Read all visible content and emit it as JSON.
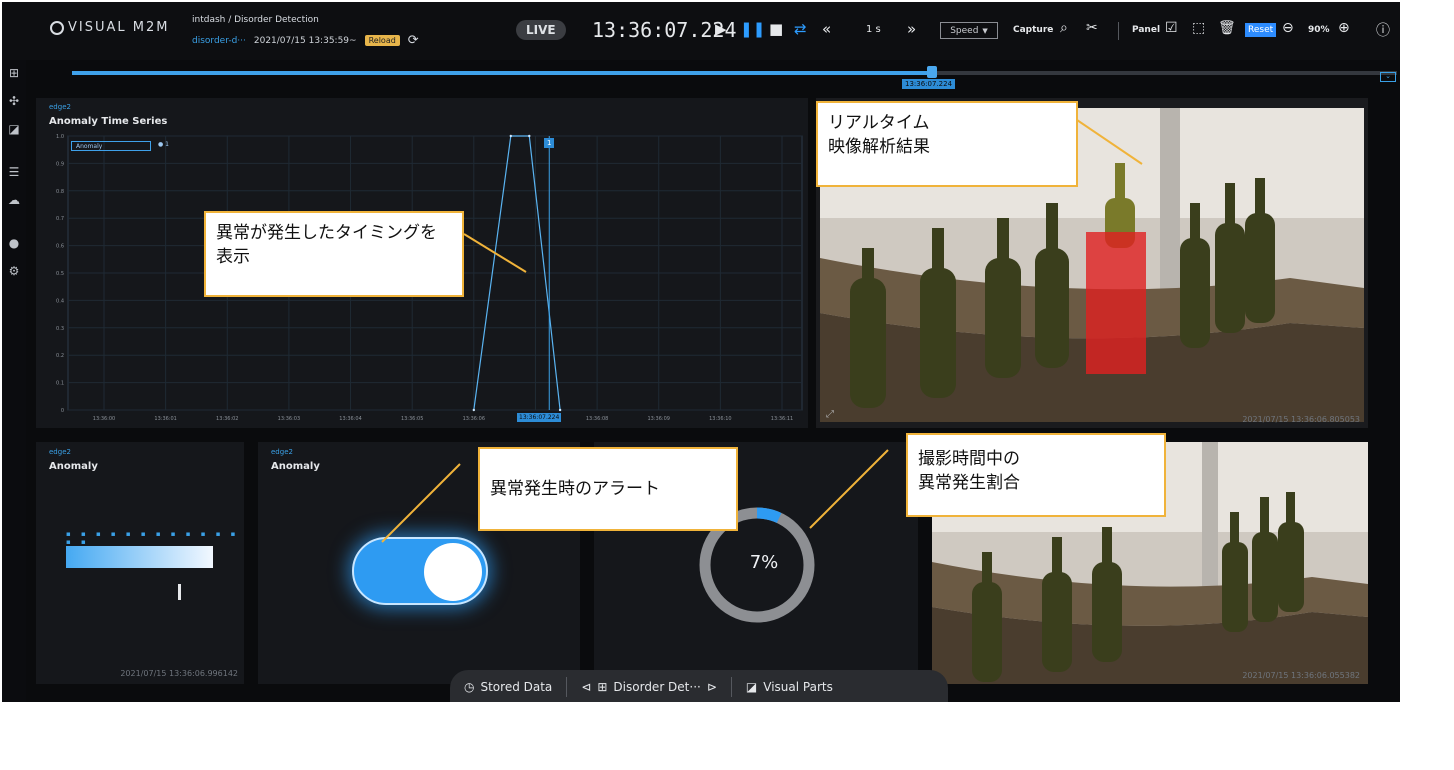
{
  "app": {
    "logo": "VISUAL M2M",
    "breadcrumb": "intdash / Disorder Detection",
    "project_select": "disorder-d···",
    "datetime": "2021/07/15 13:35:59~",
    "reload_label": "Reload"
  },
  "toolbar": {
    "live_label": "LIVE",
    "clock": "13:36:07.224",
    "step_label": "1 s",
    "speed_label": "Speed",
    "capture_label": "Capture",
    "panel_label": "Panel",
    "reset_label": "Reset",
    "zoom_label": "90%"
  },
  "timeline": {
    "marker_label": "13:36:07.224",
    "progress_fraction": 0.65
  },
  "anomaly_series_panel": {
    "edge": "edge2",
    "title": "Anomaly Time Series",
    "legend_label": "Anomaly",
    "legend_value": "● 1",
    "cursor_label": "1",
    "cursor_time": "13:36:07.224"
  },
  "chart_data": {
    "type": "line",
    "title": "Anomaly Time Series",
    "xlabel": "",
    "ylabel": "",
    "x": [
      "13:36:00",
      "13:36:01",
      "13:36:02",
      "13:36:03",
      "13:36:04",
      "13:36:05",
      "13:36:06",
      "13:36:07",
      "13:36:08",
      "13:36:09",
      "13:36:10",
      "13:36:11"
    ],
    "yticks": [
      "1.0",
      "0.9",
      "0.8",
      "0.7",
      "0.6",
      "0.5",
      "0.4",
      "0.3",
      "0.2",
      "0.1",
      "0"
    ],
    "ylim": [
      0,
      1
    ],
    "series": [
      {
        "name": "Anomaly",
        "points": [
          [
            6.0,
            0
          ],
          [
            6.6,
            1
          ],
          [
            6.9,
            1
          ],
          [
            7.4,
            0
          ]
        ]
      }
    ],
    "grid": true,
    "legend": "top-left"
  },
  "gauge_panel": {
    "edge": "edge2",
    "title": "Anomaly",
    "timestamp": "2021/07/15 13:36:06.996142",
    "tick_marks": "▪ ▪ ▪ ▪ ▪ ▪ ▪ ▪ ▪ ▪ ▪ ▪ ▪ ▪"
  },
  "toggle_panel": {
    "edge": "edge2",
    "title": "Anomaly",
    "state": "on"
  },
  "donut_panel": {
    "value_label": "7%",
    "value": 7
  },
  "video_top": {
    "timestamp": "2021/07/15 13:36:06.805053"
  },
  "video_bottom": {
    "timestamp": "2021/07/15 13:36:06.055382"
  },
  "callouts": {
    "realtime": "リアルタイム\n映像解析結果",
    "timing": "異常が発生したタイミングを表示",
    "alert": "異常発生時のアラート",
    "ratio": "撮影時間中の\n異常発生割合"
  },
  "bottom_bar": {
    "stored_data": "Stored Data",
    "screen_name": "Disorder Det···",
    "visual_parts": "Visual Parts"
  }
}
